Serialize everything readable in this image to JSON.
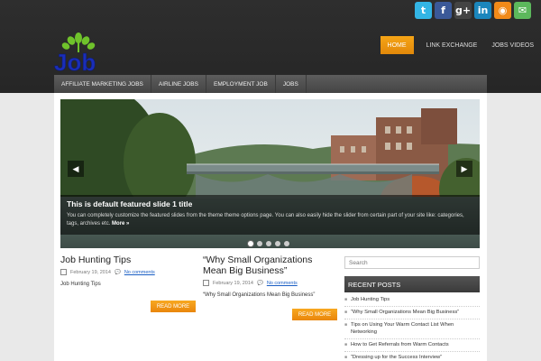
{
  "social": [
    {
      "name": "twitter-icon",
      "glyph": "t",
      "color": "#33b5e5"
    },
    {
      "name": "facebook-icon",
      "glyph": "f",
      "color": "#3b5998"
    },
    {
      "name": "google-plus-icon",
      "glyph": "g+",
      "color": "#444444"
    },
    {
      "name": "linkedin-icon",
      "glyph": "in",
      "color": "#1b86bc"
    },
    {
      "name": "rss-icon",
      "glyph": "◉",
      "color": "#f18a19"
    },
    {
      "name": "email-icon",
      "glyph": "✉",
      "color": "#5cb85c"
    }
  ],
  "logo": {
    "text": "Job"
  },
  "topnav": [
    {
      "label": "HOME",
      "active": true
    },
    {
      "label": "LINK EXCHANGE",
      "active": false
    },
    {
      "label": "JOBS VIDEOS",
      "active": false
    }
  ],
  "catnav": [
    "AFFILIATE MARKETING JOBS",
    "AIRLINE JOBS",
    "EMPLOYMENT JOB",
    "JOBS"
  ],
  "slider": {
    "title": "This is default featured slide 1 title",
    "description": "You can completely customize the featured slides from the theme theme options page. You can also easily hide the slider from certain part of your site like: categories, tags, archives etc.",
    "more": "More »",
    "dots": 5,
    "active_dot": 0
  },
  "posts": [
    {
      "title": "Job Hunting Tips",
      "date": "February 19, 2014",
      "comments": "No comments",
      "excerpt": "Job Hunting Tips",
      "readmore": "READ MORE"
    },
    {
      "title": "“Why Small Organizations Mean Big Business”",
      "date": "February 19, 2014",
      "comments": "No comments",
      "excerpt": "“Why Small Organizations Mean Big Business”",
      "readmore": "READ MORE"
    }
  ],
  "sidebar": {
    "search_placeholder": "Search",
    "recent_title": "RECENT POSTS",
    "recent": [
      "Job Hunting Tips",
      "“Why Small Organizations Mean Big Business”",
      "Tips on Using Your Warm Contact List When Networking",
      "How to Get Referrals from Warm Contacts",
      "“Dressing up for the Success Interview”"
    ]
  }
}
